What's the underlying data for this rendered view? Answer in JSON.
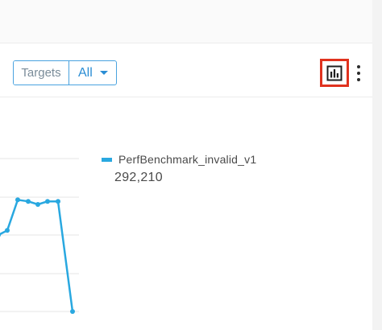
{
  "toolbar": {
    "filter_label": "Targets",
    "filter_value": "All",
    "chart_toggle_icon": "bar-chart-icon",
    "more_icon": "more-vertical-icon"
  },
  "legend": {
    "series_name": "PerfBenchmark_invalid_v1",
    "series_value": "292,210",
    "color": "#29a8e0"
  },
  "chart_data": {
    "type": "line",
    "series": [
      {
        "name": "PerfBenchmark_invalid_v1",
        "values": [
          0.5,
          0.53,
          0.73,
          0.72,
          0.7,
          0.72,
          0.72,
          0.0
        ]
      }
    ],
    "grid": true,
    "highlight_color": "#e0321e"
  }
}
